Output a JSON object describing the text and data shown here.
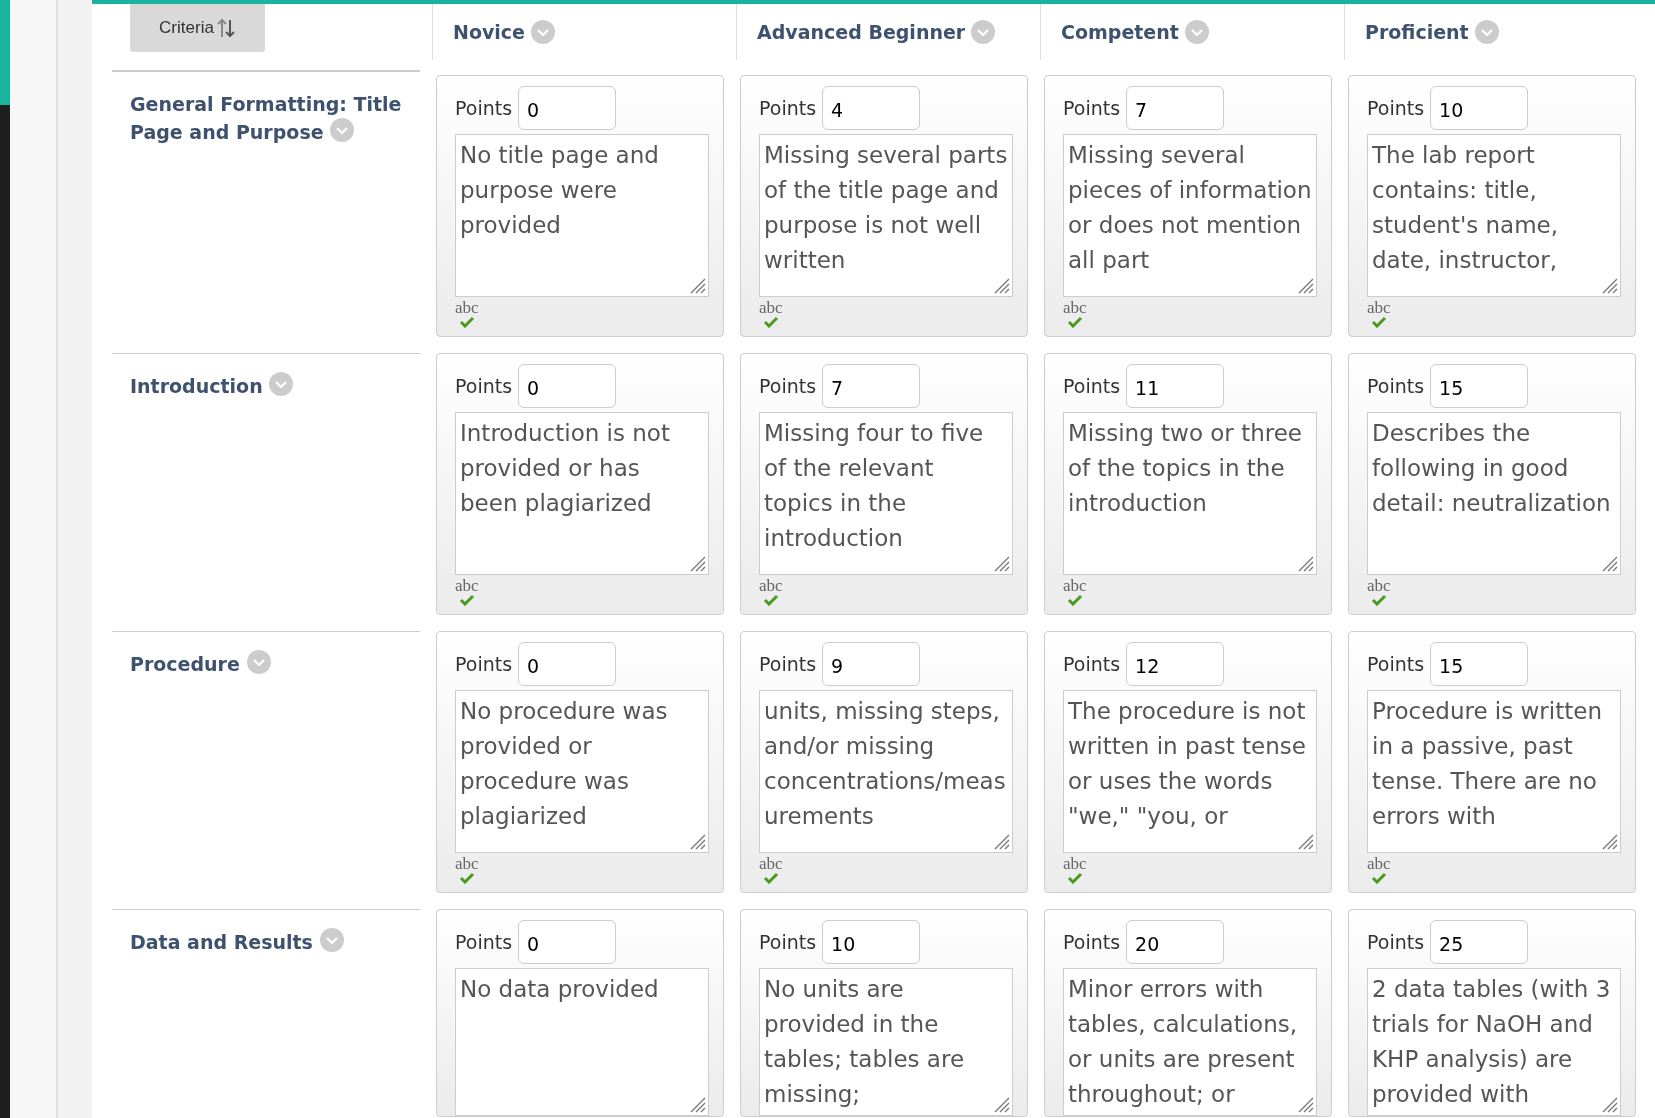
{
  "criteria_button": {
    "label": "Criteria"
  },
  "levels": [
    "Novice",
    "Advanced Beginner",
    "Competent",
    "Proficient"
  ],
  "rows": [
    {
      "name": "General Formatting: Title Page and Purpose",
      "cells": [
        {
          "points_label": "Points",
          "points": "0",
          "text": "No title page and purpose were provided",
          "spellcheck": "abc"
        },
        {
          "points_label": "Points",
          "points": "4",
          "text": "Missing several parts of the title page and purpose is not well written",
          "spellcheck": "abc"
        },
        {
          "points_label": "Points",
          "points": "7",
          "text": "Missing several pieces of information or does not mention all part",
          "spellcheck": "abc"
        },
        {
          "points_label": "Points",
          "points": "10",
          "text": "The lab report contains: title, student's name, date, instructor,",
          "spellcheck": "abc"
        }
      ]
    },
    {
      "name": "Introduction",
      "cells": [
        {
          "points_label": "Points",
          "points": "0",
          "text": "Introduction is not provided or has been plagiarized",
          "spellcheck": "abc"
        },
        {
          "points_label": "Points",
          "points": "7",
          "text": "Missing four to five of the relevant topics in the introduction",
          "spellcheck": "abc"
        },
        {
          "points_label": "Points",
          "points": "11",
          "text": "Missing two or three of the topics in the introduction",
          "spellcheck": "abc"
        },
        {
          "points_label": "Points",
          "points": "15",
          "text": "Describes the following in good detail: neutralization",
          "spellcheck": "abc"
        }
      ]
    },
    {
      "name": "Procedure",
      "cells": [
        {
          "points_label": "Points",
          "points": "0",
          "text": "No procedure was provided or procedure was plagiarized",
          "spellcheck": "abc"
        },
        {
          "points_label": "Points",
          "points": "9",
          "text": "units, missing steps, and/or missing concentrations/measurements",
          "spellcheck": "abc"
        },
        {
          "points_label": "Points",
          "points": "12",
          "text": "The procedure is not written in past tense or uses the words \"we,\" \"you, or",
          "spellcheck": "abc"
        },
        {
          "points_label": "Points",
          "points": "15",
          "text": "Procedure is written in a passive, past tense. There are no errors with",
          "spellcheck": "abc"
        }
      ]
    },
    {
      "name": "Data and Results",
      "cells": [
        {
          "points_label": "Points",
          "points": "0",
          "text": "No data provided"
        },
        {
          "points_label": "Points",
          "points": "10",
          "text": "No units are provided in the tables; tables are missing;"
        },
        {
          "points_label": "Points",
          "points": "20",
          "text": "Minor errors with tables, calculations, or units are present throughout; or"
        },
        {
          "points_label": "Points",
          "points": "25",
          "text": "2 data tables (with 3 trials for NaOH and KHP analysis) are provided with"
        }
      ]
    }
  ]
}
